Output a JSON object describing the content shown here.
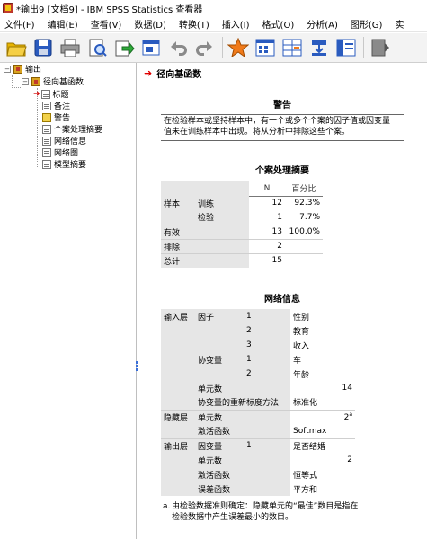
{
  "window": {
    "title": "*输出9 [文档9] - IBM SPSS Statistics 查看器"
  },
  "menu": [
    {
      "label": "文件(F)"
    },
    {
      "label": "编辑(E)"
    },
    {
      "label": "查看(V)"
    },
    {
      "label": "数据(D)"
    },
    {
      "label": "转换(T)"
    },
    {
      "label": "插入(I)"
    },
    {
      "label": "格式(O)"
    },
    {
      "label": "分析(A)"
    },
    {
      "label": "图形(G)"
    },
    {
      "label": "实"
    }
  ],
  "toolbar": {
    "buttons": [
      "open-icon",
      "save-icon",
      "print-icon",
      "print-preview-icon",
      "export-icon",
      "recall-dialog-icon",
      "undo-icon",
      "redo-icon",
      "goto-case-icon",
      "goto-variable-icon",
      "insert-cases-icon",
      "insert-variables-icon",
      "designate-window-icon",
      "more-icon"
    ]
  },
  "outline": {
    "root": "输出",
    "procedure": "径向基函数",
    "children": [
      "标题",
      "备注",
      "警告",
      "个案处理摘要",
      "网络信息",
      "网络图",
      "模型摘要"
    ]
  },
  "content": {
    "section_title": "径向基函数",
    "warning": {
      "title": "警告",
      "text_line1": "在检验样本或坚持样本中，有一个或多个个案的因子值或因变量",
      "text_line2": "值未在训练样本中出现。将从分析中排除这些个案。"
    },
    "case_summary": {
      "title": "个案处理摘要",
      "col_n": "N",
      "col_pct": "百分比",
      "rows": [
        {
          "group": "样本",
          "sub": "训练",
          "n": "12",
          "pct": "92.3%"
        },
        {
          "group": "",
          "sub": "检验",
          "n": "1",
          "pct": "7.7%"
        },
        {
          "group": "有效",
          "sub": "",
          "n": "13",
          "pct": "100.0%"
        },
        {
          "group": "排除",
          "sub": "",
          "n": "2",
          "pct": ""
        },
        {
          "group": "总计",
          "sub": "",
          "n": "15",
          "pct": ""
        }
      ]
    },
    "network_info": {
      "title": "网络信息",
      "rows": [
        {
          "c1": "输入层",
          "c2": "因子",
          "c3": "1",
          "c4": "性别"
        },
        {
          "c1": "",
          "c2": "",
          "c3": "2",
          "c4": "教育"
        },
        {
          "c1": "",
          "c2": "",
          "c3": "3",
          "c4": "收入"
        },
        {
          "c1": "",
          "c2": "协变量",
          "c3": "1",
          "c4": "车"
        },
        {
          "c1": "",
          "c2": "",
          "c3": "2",
          "c4": "年龄"
        },
        {
          "c1": "",
          "c2": "单元数",
          "c3": "",
          "c4": "14"
        },
        {
          "c1": "",
          "c2": "协变量的重新标度方法",
          "c3": "",
          "c4": "标准化"
        },
        {
          "c1": "隐藏层",
          "c2": "单元数",
          "c3": "",
          "c4": "2",
          "sup": "a"
        },
        {
          "c1": "",
          "c2": "激活函数",
          "c3": "",
          "c4": "Softmax"
        },
        {
          "c1": "输出层",
          "c2": "因变量",
          "c3": "1",
          "c4": "是否结婚"
        },
        {
          "c1": "",
          "c2": "单元数",
          "c3": "",
          "c4": "2"
        },
        {
          "c1": "",
          "c2": "激活函数",
          "c3": "",
          "c4": "恒等式"
        },
        {
          "c1": "",
          "c2": "误差函数",
          "c3": "",
          "c4": "平方和"
        }
      ],
      "footnote_mark": "a.",
      "footnote": "由检验数据准则确定：隐藏单元的“最佳”数目是指在检验数据中产生误差最小的数目。"
    }
  }
}
